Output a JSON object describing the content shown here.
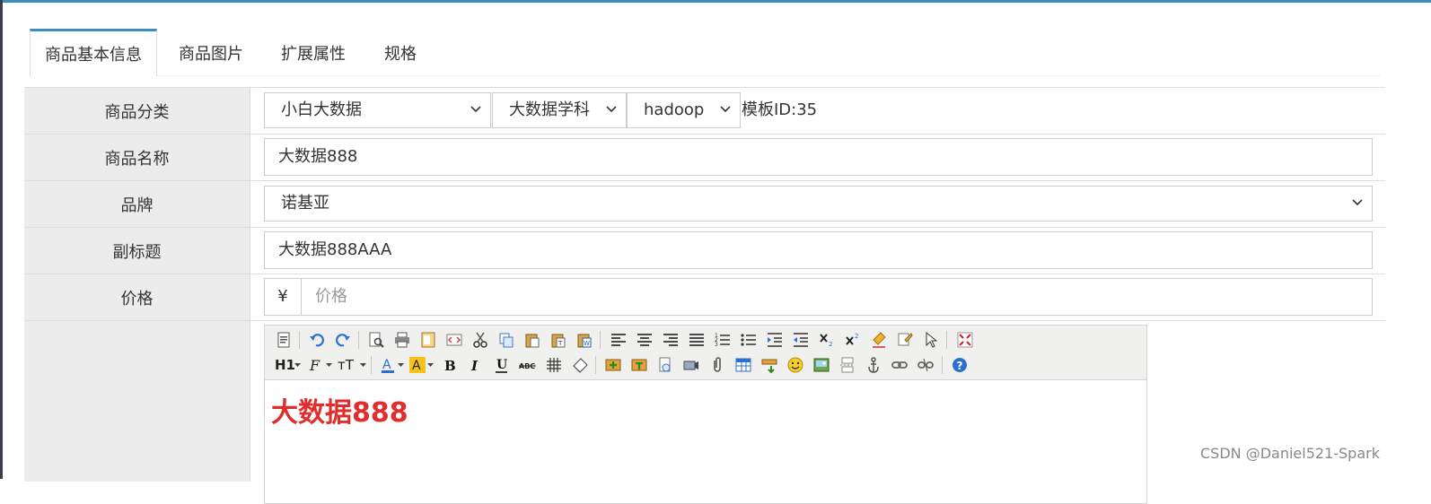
{
  "tabs": [
    "商品基本信息",
    "商品图片",
    "扩展属性",
    "规格"
  ],
  "form": {
    "category_label": "商品分类",
    "category1": "小白大数据",
    "category2": "大数据学科",
    "category3": "hadoop",
    "template_id_text": "模板ID:35",
    "name_label": "商品名称",
    "name_value": "大数据888",
    "brand_label": "品牌",
    "brand_value": "诺基亚",
    "subtitle_label": "副标题",
    "subtitle_value": "大数据888AAA",
    "price_label": "价格",
    "price_prefix": "¥",
    "price_placeholder": "价格"
  },
  "editor": {
    "toolbar_text": {
      "heading": "H1",
      "font_size": "тT"
    },
    "content": "大数据888",
    "content_color": "#e02e2e"
  },
  "colors": {
    "accent": "#3c8dbc",
    "label_bg": "#ececec"
  },
  "watermark": "CSDN @Daniel521-Spark"
}
